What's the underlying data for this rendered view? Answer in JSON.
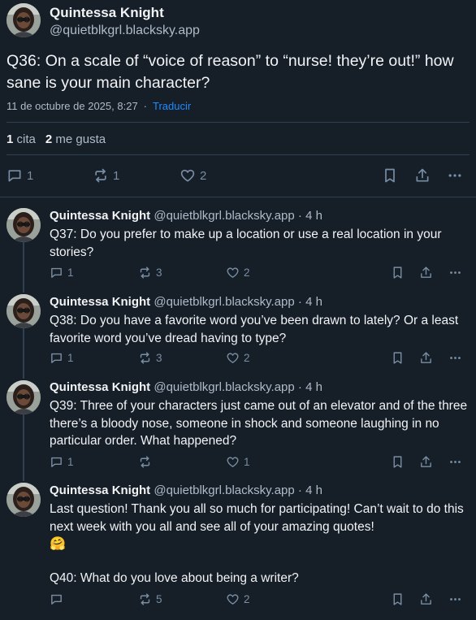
{
  "main_post": {
    "author_name": "Quintessa Knight",
    "author_handle": "@quietblkgrl.blacksky.app",
    "text": "Q36: On a scale of “voice of reason” to “nurse! they’re out!” how sane is your main character?",
    "timestamp": "11 de octubre de 2025, 8:27",
    "separator": "·",
    "translate_label": "Traducir",
    "quotes_count": "1",
    "quotes_label": "cita",
    "likes_count": "2",
    "likes_label": "me gusta",
    "actions": {
      "replies": "1",
      "reposts": "1",
      "likes": "2"
    }
  },
  "replies": [
    {
      "author_name": "Quintessa Knight",
      "author_handle": "@quietblkgrl.blacksky.app",
      "time": "· 4 h",
      "text": "Q37: Do you prefer to make up a location or use a real location in your stories?",
      "replies": "1",
      "reposts": "3",
      "likes": "2"
    },
    {
      "author_name": "Quintessa Knight",
      "author_handle": "@quietblkgrl.blacksky.app",
      "time": "· 4 h",
      "text": "Q38: Do you have a favorite word you’ve been drawn to lately? Or a least favorite word you’ve dread having to type?",
      "replies": "1",
      "reposts": "3",
      "likes": "2"
    },
    {
      "author_name": "Quintessa Knight",
      "author_handle": "@quietblkgrl.blacksky.app",
      "time": "· 4 h",
      "text": "Q39: Three of your characters just came out of an elevator and of the three there’s a bloody nose, someone in shock and someone laughing in no particular order. What happened?",
      "replies": "1",
      "reposts": "",
      "likes": "1"
    },
    {
      "author_name": "Quintessa Knight",
      "author_handle": "@quietblkgrl.blacksky.app",
      "time": "· 4 h",
      "text": "Last question! Thank you all so much for participating! Can’t wait to do this next week with you all and see all of your amazing quotes!",
      "emoji": "🤗",
      "text2": "Q40: What do you love about being a writer?",
      "replies": "",
      "reposts": "5",
      "likes": "2"
    }
  ],
  "icons": [
    "reply-icon",
    "repost-icon",
    "like-icon",
    "bookmark-icon",
    "share-icon",
    "more-icon"
  ],
  "colors": {
    "background": "#161e27",
    "text": "#f1f3f5",
    "muted": "#aebbc9",
    "icon": "#788ea5",
    "link": "#208bfe",
    "divider": "#2e4052"
  }
}
